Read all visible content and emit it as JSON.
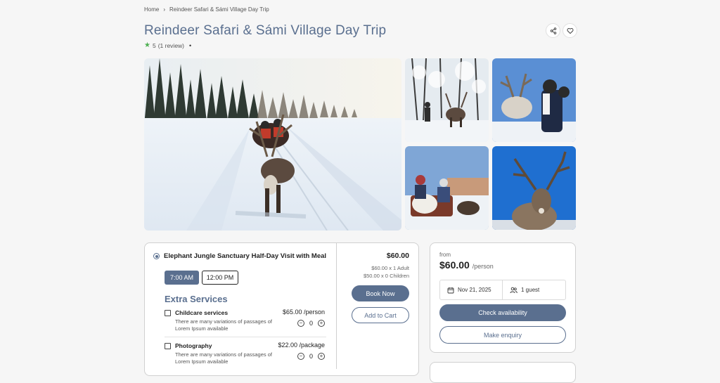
{
  "breadcrumb": {
    "home": "Home",
    "separator": "›",
    "current": "Reindeer Safari & Sámi Village Day Trip"
  },
  "title": "Reindeer Safari & Sámi Village Day Trip",
  "rating": {
    "score": "5",
    "reviews": "(1 review)",
    "star_color": "#4caf50"
  },
  "actions": {
    "share_icon": "share-icon",
    "favorite_icon": "heart-icon"
  },
  "gallery": {
    "main_alt": "Reindeer pulling a sleigh with two riders on a snowy forest trail",
    "thumbs": [
      "Reindeer in snowy birch forest",
      "Woman feeding a reindeer under blue sky",
      "Sleigh riders in a snowy village",
      "Reindeer with large antlers against blue sky"
    ]
  },
  "option": {
    "title": "Elephant Jungle Sanctuary Half-Day Visit with Meal",
    "times": [
      "7:00 AM",
      "12:00 PM"
    ],
    "selected_time": "7:00 AM"
  },
  "extra_services": {
    "heading": "Extra Services",
    "items": [
      {
        "name": "Childcare services",
        "description": "There are many variations of passages of Lorem Ipsum available",
        "price": "$65.00 /person",
        "qty": "0"
      },
      {
        "name": "Photography",
        "description": "There are many variations of passages of Lorem Ipsum available",
        "price": "$22.00 /package",
        "qty": "0"
      }
    ]
  },
  "summary": {
    "total": "$60.00",
    "adult_line": "$60.00 x 1 Adult",
    "child_line": "$50.00 x 0 Children",
    "book_now": "Book Now",
    "add_to_cart": "Add to Cart"
  },
  "booking": {
    "from_label": "from",
    "price": "$60.00",
    "per": "/person",
    "date": "Nov 21, 2025",
    "guests": "1 guest",
    "check_availability": "Check availability",
    "make_enquiry": "Make enquiry"
  },
  "colors": {
    "accent": "#5a6f8f",
    "background": "#f6f6f6"
  }
}
